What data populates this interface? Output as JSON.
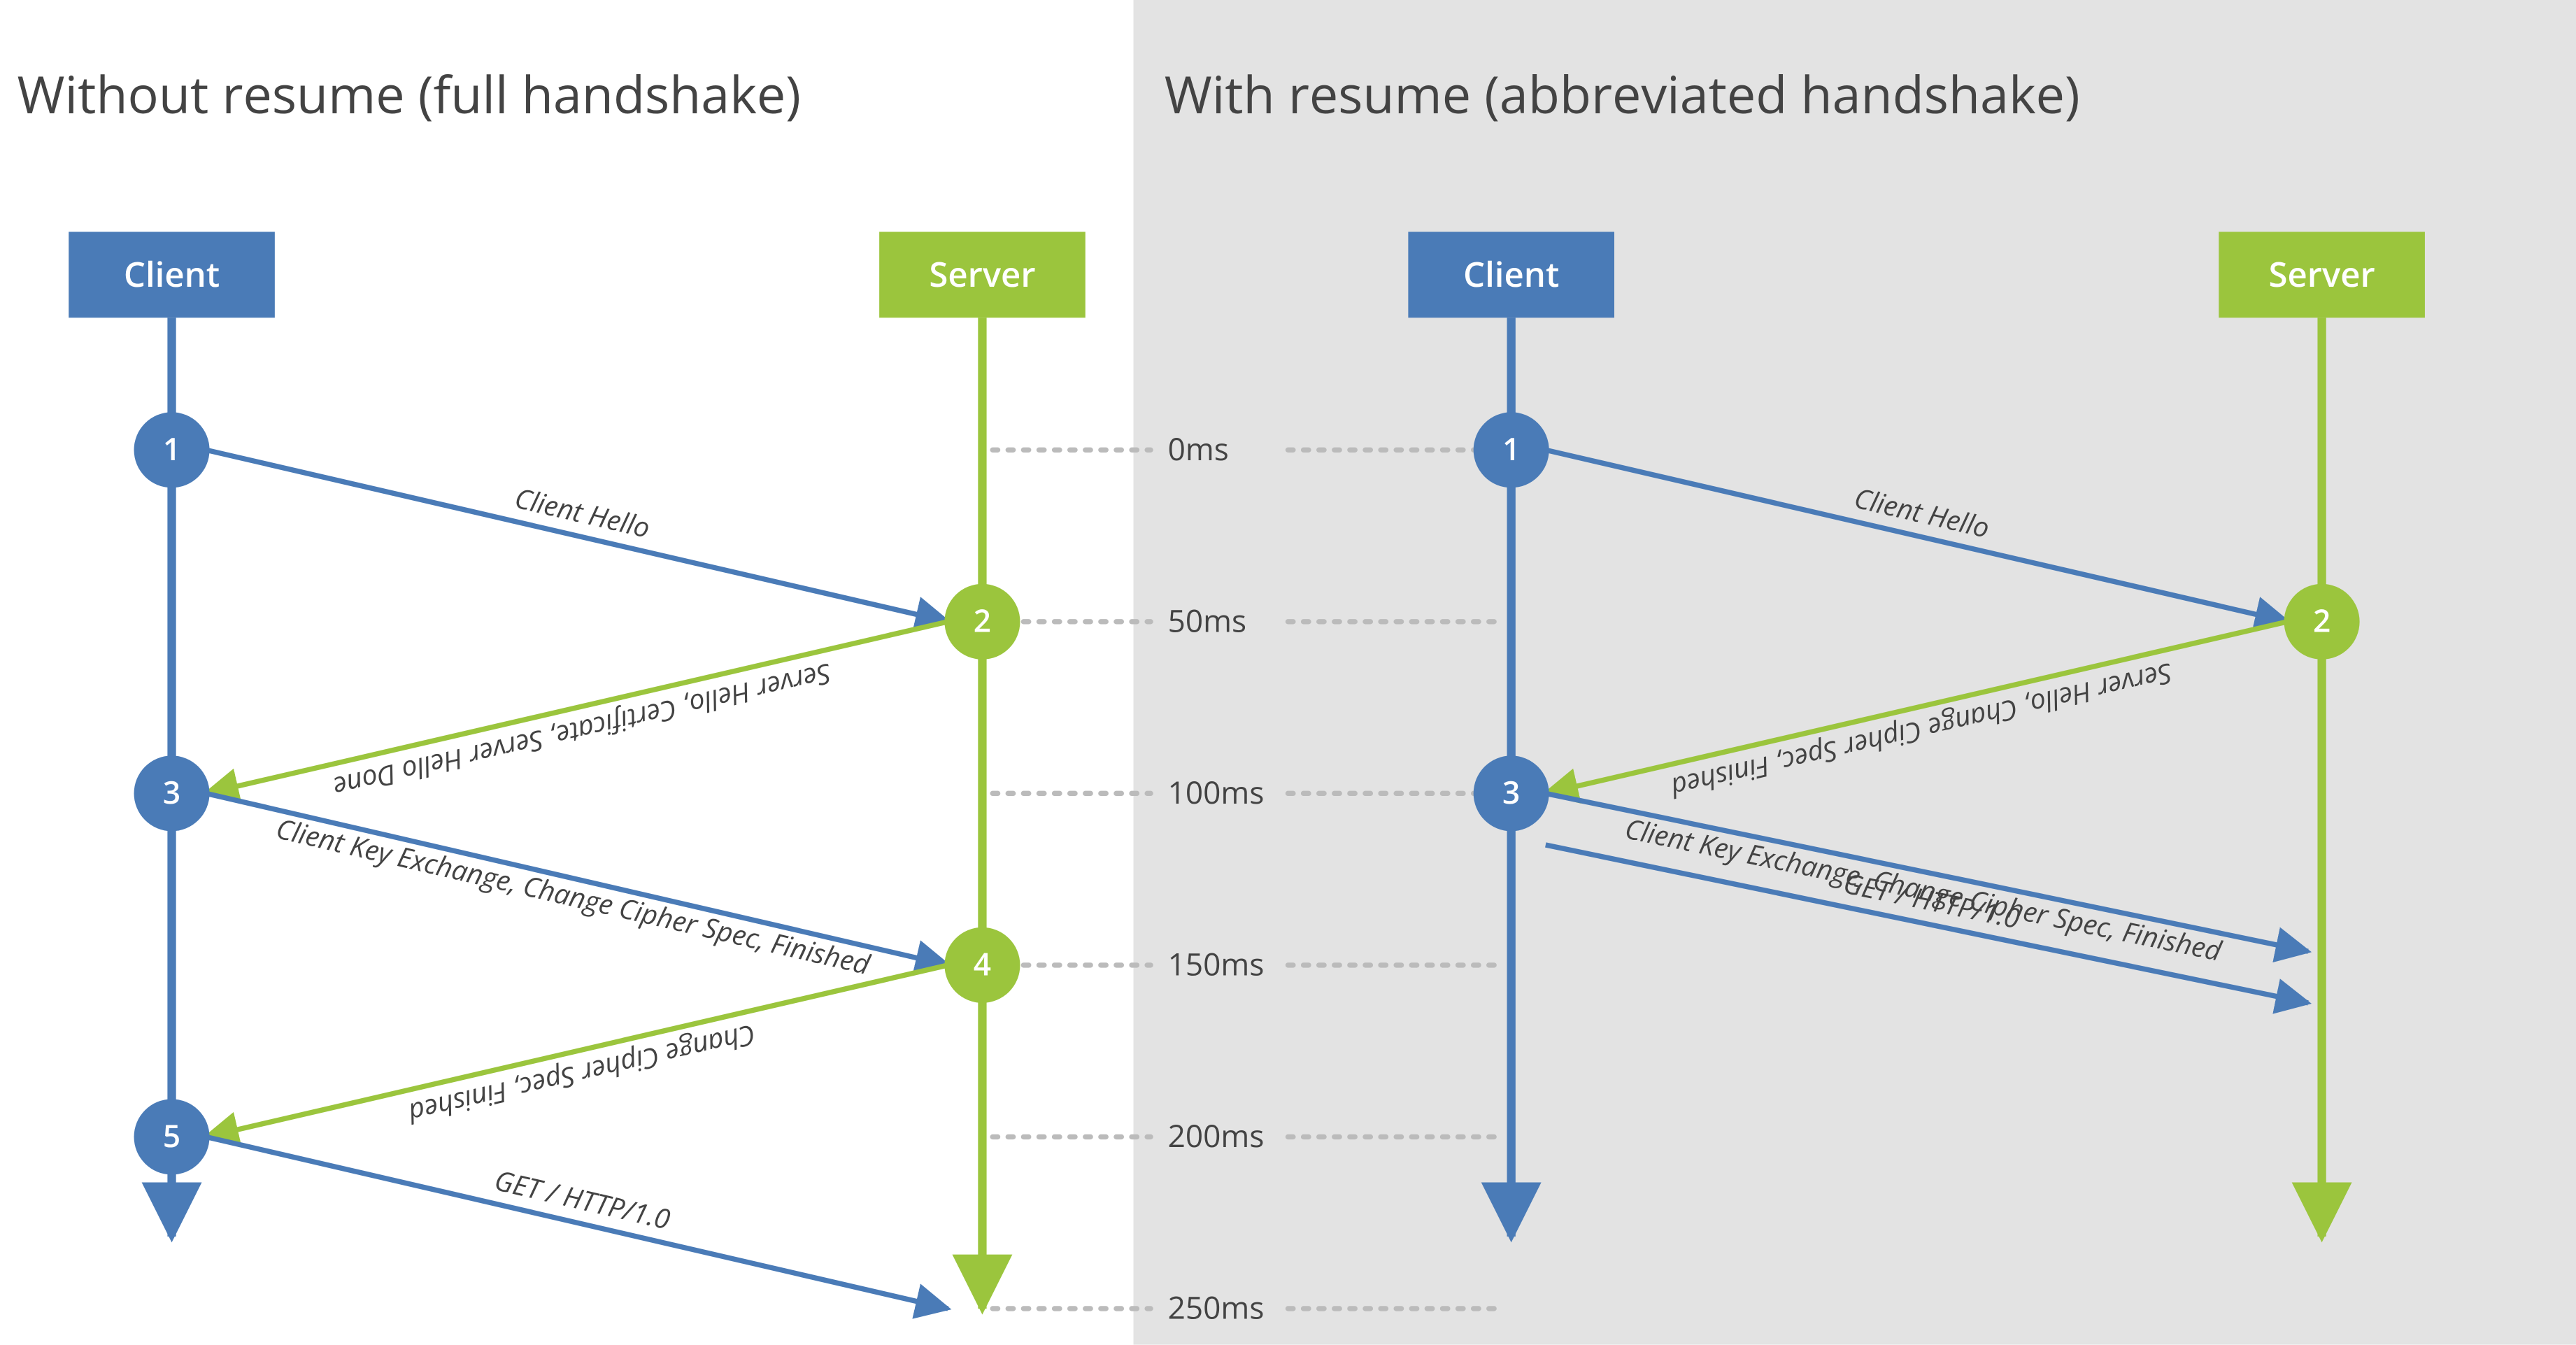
{
  "colors": {
    "blue": "#4A7BB7",
    "green": "#9BC53D",
    "gray_bg": "#E3E3E3",
    "text": "#434343",
    "dotted": "#BBBBBB"
  },
  "titles": {
    "left": "Without resume (full handshake)",
    "right": "With resume (abbreviated handshake)"
  },
  "labels": {
    "client": "Client",
    "server": "Server"
  },
  "times": [
    "0ms",
    "50ms",
    "100ms",
    "150ms",
    "200ms",
    "250ms"
  ],
  "left": {
    "steps": [
      "1",
      "2",
      "3",
      "4",
      "5"
    ],
    "messages": [
      "Client Hello",
      "Server Hello, Certificate, Server Hello Done",
      "Client Key Exchange, Change Cipher Spec, Finished",
      "Change Cipher Spec, Finished",
      "GET / HTTP/1.0"
    ]
  },
  "right": {
    "steps": [
      "1",
      "2",
      "3"
    ],
    "messages": [
      "Client Hello",
      "Server Hello, Change Cipher Spec, Finished",
      "Client Key Exchange, Change Cipher Spec, Finished",
      "GET / HTTP/1.0"
    ]
  }
}
